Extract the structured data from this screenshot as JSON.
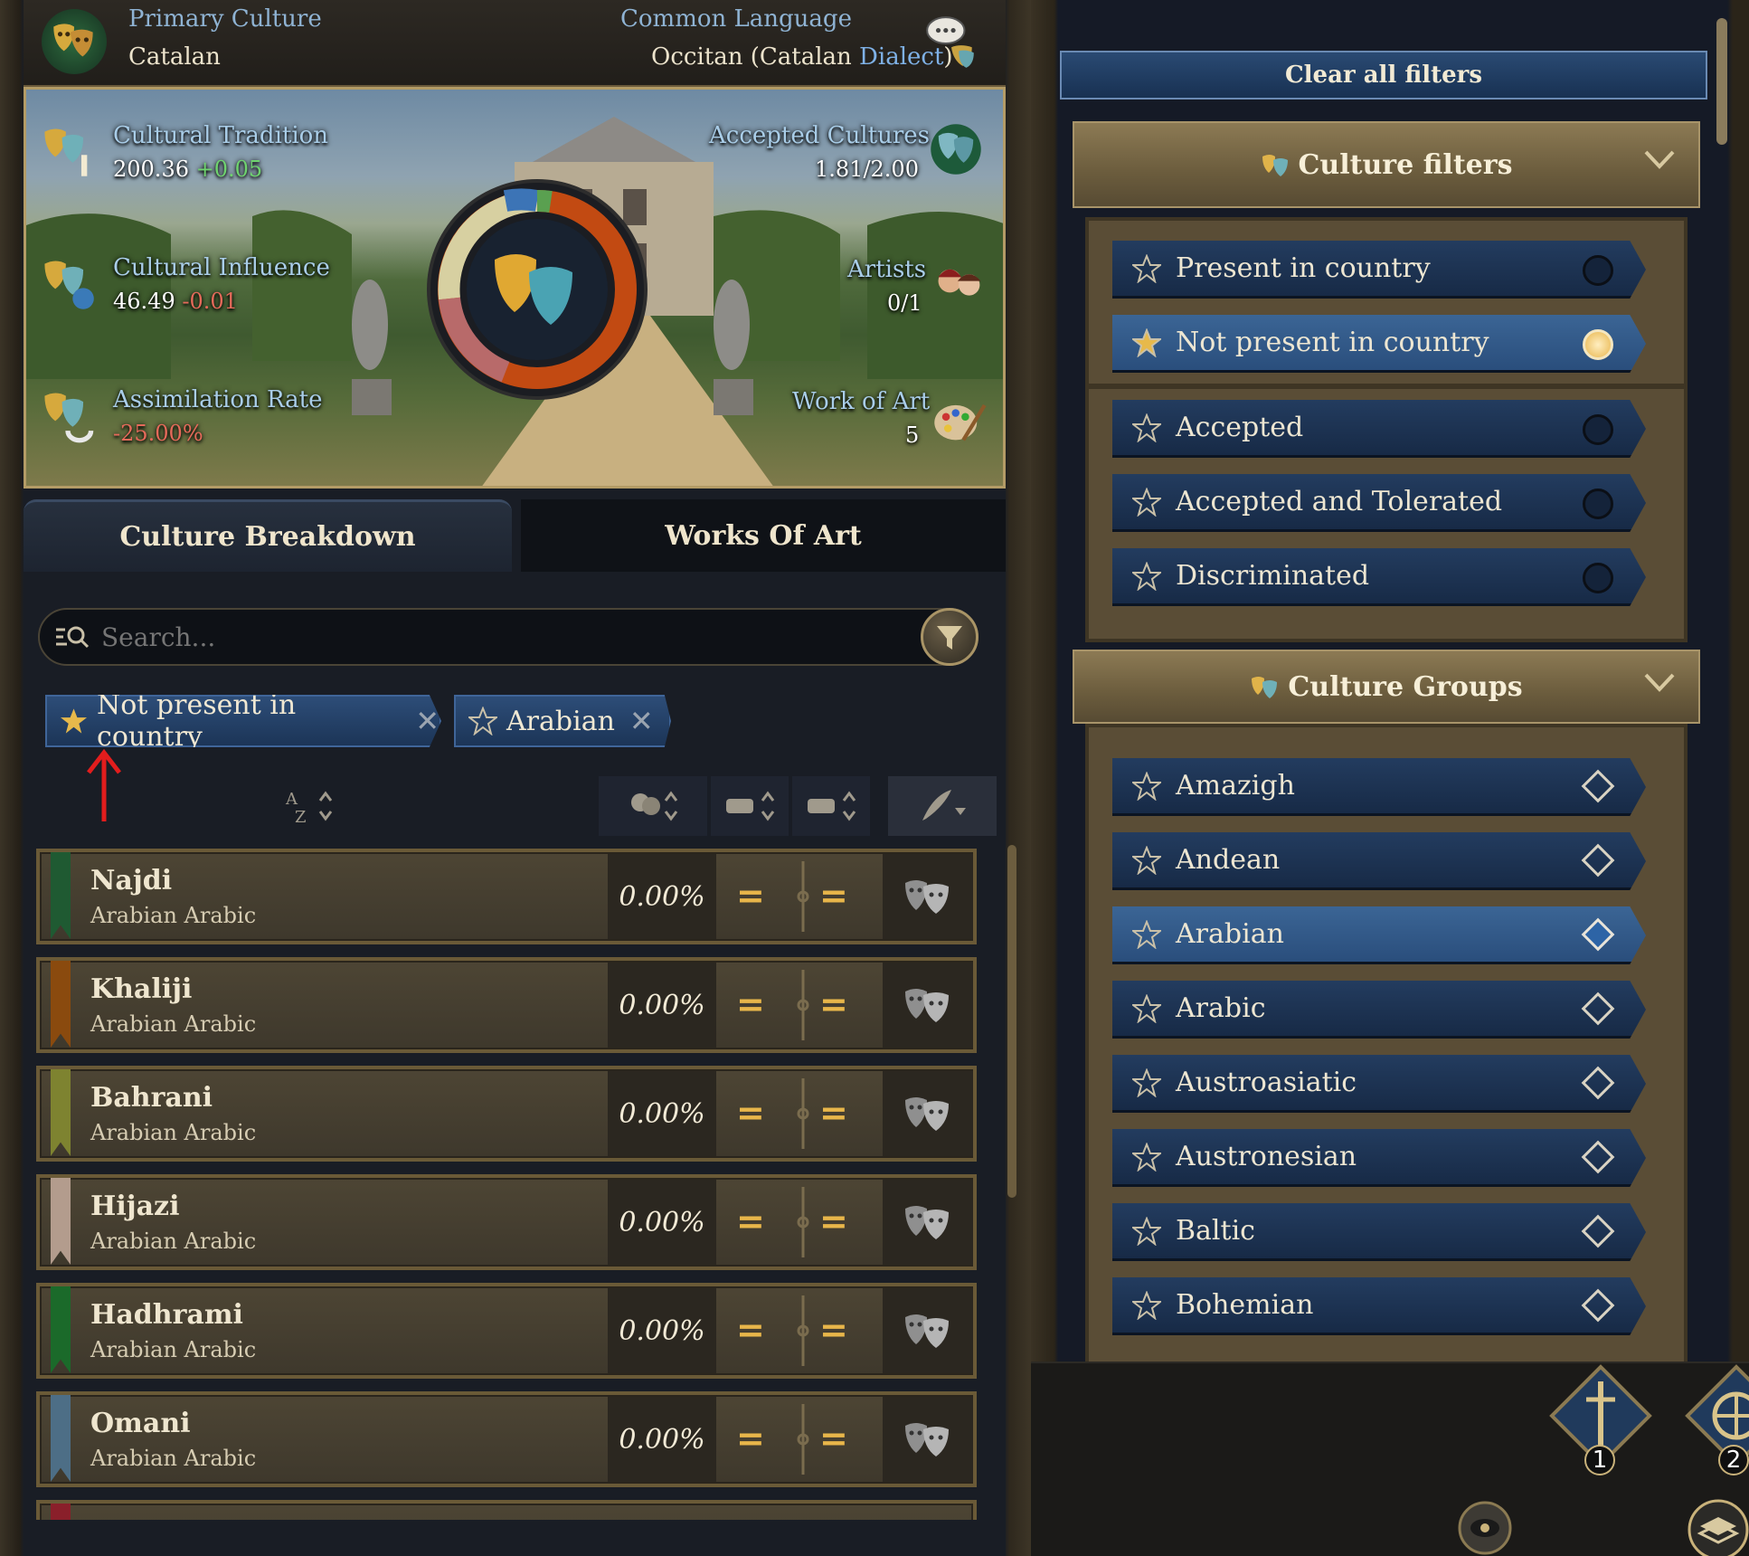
{
  "header": {
    "primary_culture_label": "Primary Culture",
    "primary_culture_value": "Catalan",
    "common_language_label": "Common Language",
    "common_language_value": "Occitan (Catalan ",
    "common_language_dialect": "Dialect",
    "common_language_close": ")"
  },
  "stats": {
    "cultural_tradition_label": "Cultural Tradition",
    "cultural_tradition_value": "200.36",
    "cultural_tradition_delta": "+0.05",
    "cultural_influence_label": "Cultural Influence",
    "cultural_influence_value": "46.49",
    "cultural_influence_delta": "-0.01",
    "assimilation_rate_label": "Assimilation Rate",
    "assimilation_rate_value": "-25.00%",
    "accepted_cultures_label": "Accepted Cultures",
    "accepted_cultures_value": "1.81/2.00",
    "artists_label": "Artists",
    "artists_value": "0/1",
    "work_of_art_label": "Work of Art",
    "work_of_art_value": "5"
  },
  "tabs": {
    "culture_breakdown": "Culture Breakdown",
    "works_of_art": "Works Of Art"
  },
  "search": {
    "placeholder": "Search..."
  },
  "active_chips": [
    {
      "label": "Not present in country"
    },
    {
      "label": "Arabian"
    }
  ],
  "cultures": [
    {
      "name": "Najdi",
      "group": "Arabian  Arabic",
      "pct": "0.00%",
      "color": "#1f5a32"
    },
    {
      "name": "Khaliji",
      "group": "Arabian  Arabic",
      "pct": "0.00%",
      "color": "#8a4a0e"
    },
    {
      "name": "Bahrani",
      "group": "Arabian  Arabic",
      "pct": "0.00%",
      "color": "#7e8330"
    },
    {
      "name": "Hijazi",
      "group": "Arabian  Arabic",
      "pct": "0.00%",
      "color": "#b39c8d"
    },
    {
      "name": "Hadhrami",
      "group": "Arabian  Arabic",
      "pct": "0.00%",
      "color": "#1b6a2a"
    },
    {
      "name": "Omani",
      "group": "Arabian  Arabic",
      "pct": "0.00%",
      "color": "#4d6e86"
    }
  ],
  "filters": {
    "clear_all": "Clear all filters",
    "culture_filters_title": "Culture filters",
    "culture_filters": [
      {
        "label": "Present in country",
        "selected": false
      },
      {
        "label": "Not present in country",
        "selected": true
      },
      {
        "label": "Accepted",
        "selected": false
      },
      {
        "label": "Accepted and Tolerated",
        "selected": false
      },
      {
        "label": "Discriminated",
        "selected": false
      }
    ],
    "culture_groups_title": "Culture Groups",
    "culture_groups": [
      {
        "label": "Amazigh",
        "selected": false
      },
      {
        "label": "Andean",
        "selected": false
      },
      {
        "label": "Arabian",
        "selected": true
      },
      {
        "label": "Arabic",
        "selected": false
      },
      {
        "label": "Austroasiatic",
        "selected": false
      },
      {
        "label": "Austronesian",
        "selected": false
      },
      {
        "label": "Baltic",
        "selected": false
      },
      {
        "label": "Bohemian",
        "selected": false
      }
    ]
  },
  "hud": {
    "badge_1": "1",
    "badge_2": "2"
  },
  "colors": {
    "accent_blue": "#2a4e7c",
    "gold": "#e8b64a",
    "positive": "#6fd36f",
    "negative": "#e56a5a"
  },
  "icons": [
    "theater-masks-icon",
    "speech-bubble-icon",
    "filter-funnel-icon",
    "search-icon",
    "star-icon",
    "close-icon",
    "chevron-down-icon",
    "artists-icon",
    "palette-icon",
    "sword-icon",
    "compass-icon"
  ]
}
